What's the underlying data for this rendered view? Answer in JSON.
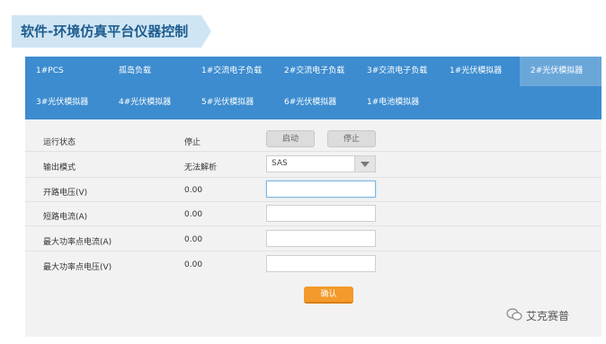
{
  "banner": {
    "title": "软件-环境仿真平台仪器控制"
  },
  "tabs": [
    {
      "label": "1#PCS"
    },
    {
      "label": "孤岛负载"
    },
    {
      "label": "1#交流电子负载"
    },
    {
      "label": "2#交流电子负载"
    },
    {
      "label": "3#交流电子负载"
    },
    {
      "label": "1#光伏模拟器"
    },
    {
      "label": "2#光伏模拟器",
      "active": true
    },
    {
      "label": "3#光伏模拟器"
    },
    {
      "label": "4#光伏模拟器"
    },
    {
      "label": "5#光伏模拟器"
    },
    {
      "label": "6#光伏模拟器"
    },
    {
      "label": "1#电池模拟器"
    }
  ],
  "form": {
    "run_state": {
      "label": "运行状态",
      "value": "停止",
      "start_label": "启动",
      "stop_label": "停止"
    },
    "output_mode": {
      "label": "输出模式",
      "value": "无法解析",
      "selected": "SAS"
    },
    "open_voltage": {
      "label": "开路电压(V)",
      "value": "0.00",
      "input": ""
    },
    "short_current": {
      "label": "短路电流(A)",
      "value": "0.00",
      "input": ""
    },
    "mpp_current": {
      "label": "最大功率点电流(A)",
      "value": "0.00",
      "input": ""
    },
    "mpp_voltage": {
      "label": "最大功率点电压(V)",
      "value": "0.00",
      "input": ""
    }
  },
  "confirm_label": "确认",
  "watermark": {
    "text": "艾克赛普"
  },
  "colors": {
    "tabbar": "#3c8ccf",
    "tab_active": "#6aa7d9",
    "confirm": "#f39a2b",
    "banner_text": "#1e5d8f"
  }
}
